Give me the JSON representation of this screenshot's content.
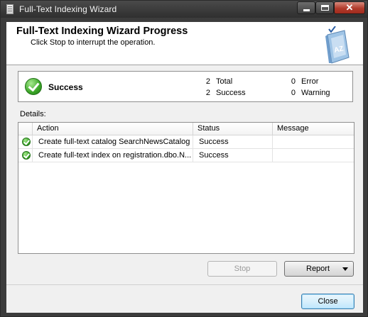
{
  "window": {
    "title": "Full-Text Indexing Wizard"
  },
  "header": {
    "title": "Full-Text Indexing Wizard Progress",
    "subtitle": "Click Stop to interrupt the operation."
  },
  "summary": {
    "status": "Success",
    "total_count": "2",
    "total_label": "Total",
    "success_count": "2",
    "success_label": "Success",
    "error_count": "0",
    "error_label": "Error",
    "warning_count": "0",
    "warning_label": "Warning"
  },
  "details": {
    "label": "Details:",
    "columns": [
      "Action",
      "Status",
      "Message"
    ],
    "rows": [
      {
        "action": "Create full-text catalog SearchNewsCatalog",
        "status": "Success",
        "message": ""
      },
      {
        "action": "Create full-text index on registration.dbo.N...",
        "status": "Success",
        "message": ""
      }
    ]
  },
  "buttons": {
    "stop": "Stop",
    "report": "Report",
    "close": "Close"
  },
  "colors": {
    "success_green": "#3aa526",
    "titlebar": "#3c3c3c"
  },
  "icons": [
    "app-icon",
    "book-az-icon",
    "success-check-icon",
    "chevron-down-icon"
  ]
}
